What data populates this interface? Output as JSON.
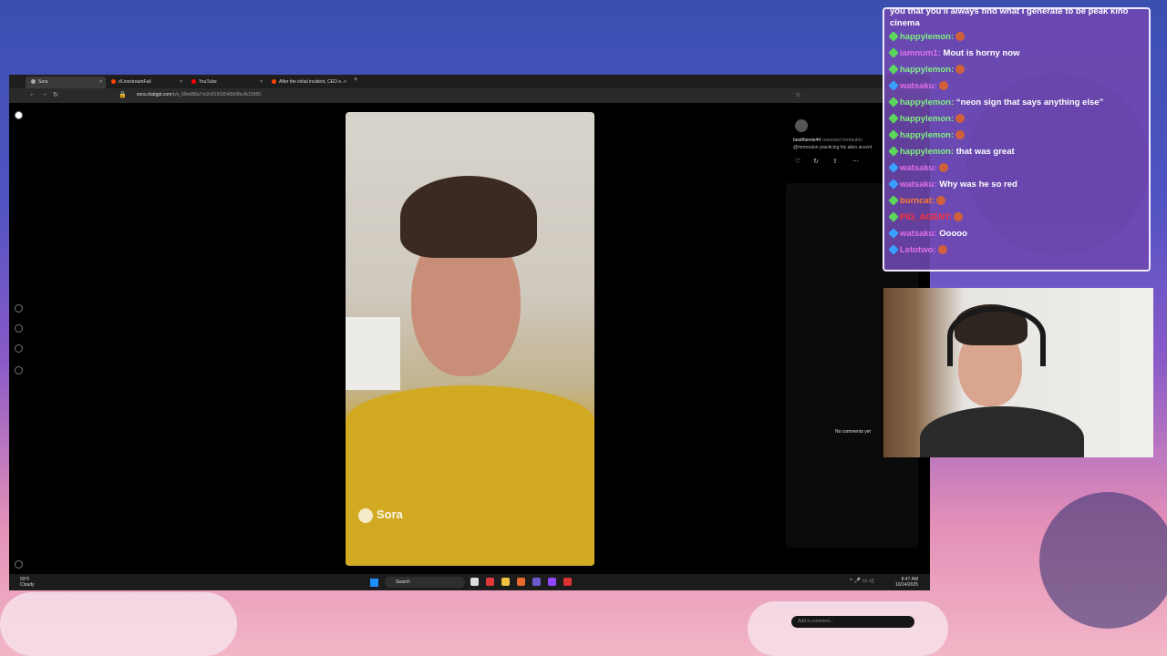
{
  "browser": {
    "tabs": [
      {
        "label": "Sora",
        "active": true
      },
      {
        "label": "r/LivestreamFail",
        "active": false
      },
      {
        "label": "YouTube",
        "active": false
      },
      {
        "label": "After the initial incident, CEO e...",
        "active": false
      }
    ],
    "url_domain": "sora.chatgpt.com",
    "url_path": "/p/s_68ed88a7cb2c81918540b08ecfb15589"
  },
  "video": {
    "watermark": "Sora"
  },
  "post": {
    "user": "bestthereis44",
    "action": "cameoed mrmouton",
    "caption": "@mrmouton practicing his alien accent",
    "no_comments": "No comments yet",
    "add_comment_placeholder": "Add a comment..."
  },
  "taskbar": {
    "weather_temp": "59°F",
    "weather_cond": "Cloudy",
    "search_label": "Search",
    "time": "8:47 AM",
    "date": "10/14/2025"
  },
  "chat": {
    "top_text": "you that you'll always find what I generate to be peak kino cinema",
    "messages": [
      {
        "user": "happylemon",
        "text": "",
        "badge": "green",
        "ucolor": "u-green"
      },
      {
        "user": "iamnum1",
        "text": "Mout is horny now",
        "badge": "green",
        "ucolor": "u-pink"
      },
      {
        "user": "happylemon",
        "text": "",
        "badge": "green",
        "ucolor": "u-green"
      },
      {
        "user": "watsaku",
        "text": "",
        "badge": "blue",
        "ucolor": "u-pink"
      },
      {
        "user": "happylemon",
        "text": "“neon sign that says anything else”",
        "badge": "green",
        "ucolor": "u-green"
      },
      {
        "user": "happylemon",
        "text": "",
        "badge": "green",
        "ucolor": "u-green"
      },
      {
        "user": "happylemon",
        "text": "",
        "badge": "green",
        "ucolor": "u-green"
      },
      {
        "user": "happylemon",
        "text": "that was great",
        "badge": "green",
        "ucolor": "u-green"
      },
      {
        "user": "watsaku",
        "text": "",
        "badge": "blue",
        "ucolor": "u-pink"
      },
      {
        "user": "watsaku",
        "text": "Why was he so red",
        "badge": "blue",
        "ucolor": "u-pink"
      },
      {
        "user": "burncat",
        "text": "",
        "badge": "green",
        "ucolor": "u-orange"
      },
      {
        "user": "PIG_AGENT",
        "text": "",
        "badge": "green",
        "ucolor": "u-red"
      },
      {
        "user": "watsaku",
        "text": "Ooooo",
        "badge": "blue",
        "ucolor": "u-pink"
      },
      {
        "user": "Letotwo",
        "text": "",
        "badge": "blue",
        "ucolor": "u-pink"
      }
    ]
  },
  "colors": {
    "chat_bg": "#6f48b0",
    "chat_border": "#f1e9ff",
    "accent_blue": "#1e90ff"
  }
}
